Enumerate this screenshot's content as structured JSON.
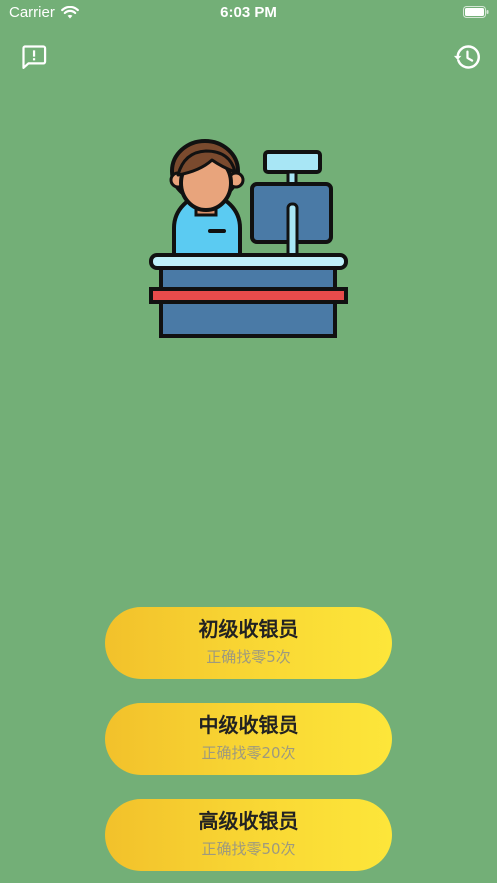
{
  "status_bar": {
    "carrier": "Carrier",
    "time": "6:03 PM"
  },
  "toolbar": {
    "feedback_icon": "feedback-icon",
    "history_icon": "history-icon"
  },
  "illustration": {
    "icon": "cashier-icon"
  },
  "levels": [
    {
      "title": "初级收银员",
      "subtitle": "正确找零5次"
    },
    {
      "title": "中级收银员",
      "subtitle": "正确找零20次"
    },
    {
      "title": "高级收银员",
      "subtitle": "正确找零50次"
    }
  ],
  "colors": {
    "background": "#73AF77",
    "button_start": "#F2C12B",
    "button_end": "#FDE63A",
    "title_text": "#222222",
    "subtitle_text": "#9E9A7E"
  }
}
